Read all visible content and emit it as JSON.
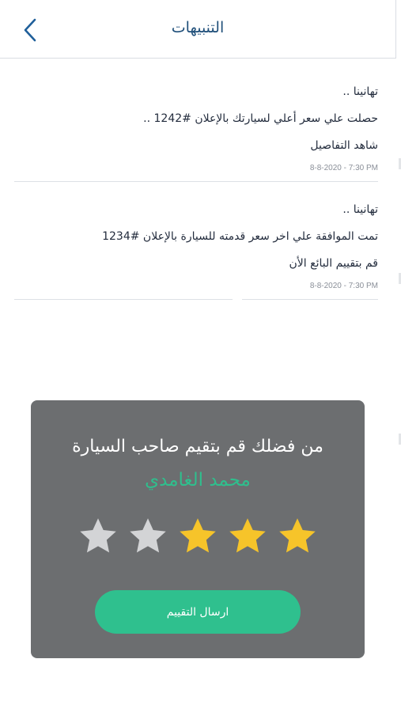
{
  "header": {
    "title": "التنبيهات",
    "back_icon": "chevron-left-icon"
  },
  "notifications": [
    {
      "greeting": "تهانينا ..",
      "message": "حصلت علي سعر أعلي لسيارتك بالإعلان #1242 ..",
      "action": "شاهد التفاصيل",
      "time": "8-8-2020 - 7:30 PM"
    },
    {
      "greeting": "تهانينا ..",
      "message": "تمت الموافقة علي اخر سعر قدمته للسيارة بالإعلان #1234",
      "action": "قم بتقييم البائع الأن",
      "time": "8-8-2020 - 7:30 PM"
    }
  ],
  "rating_dialog": {
    "title": "من فضلك قم بتقيم صاحب السيارة",
    "seller_name": "محمد الغامدي",
    "rating": 3,
    "max_rating": 5,
    "submit_label": "ارسال التقييم",
    "colors": {
      "star_filled": "#f6c42a",
      "star_empty": "#d3d4d6",
      "accent": "#2fc08e",
      "panel": "#6c6e70"
    }
  }
}
